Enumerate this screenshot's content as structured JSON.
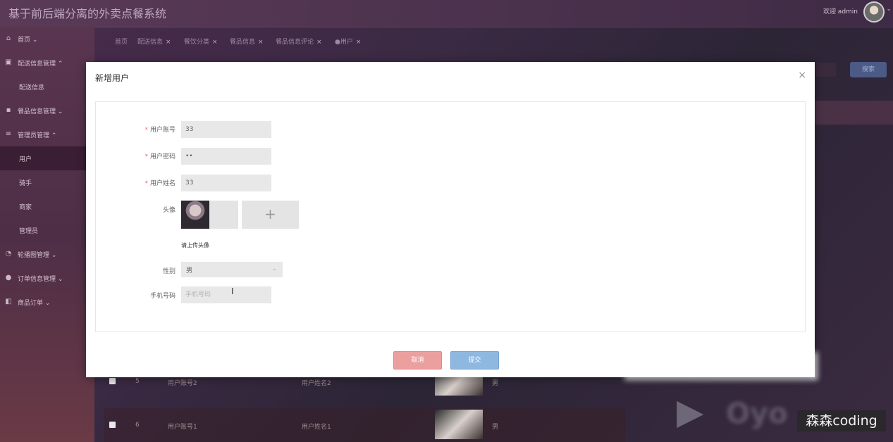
{
  "header": {
    "app_title": "基于前后端分离的外卖点餐系统",
    "welcome": "欢迎 admin",
    "avatar_icon": "user-avatar",
    "chevron_icon": "chevron-down-icon"
  },
  "sidebar": {
    "items": [
      {
        "label": "首页",
        "icon": "home-icon",
        "glyph": "⌂",
        "expand": "⌄"
      },
      {
        "label": "配送信息管理",
        "icon": "gift-icon",
        "glyph": "▣",
        "expand": "⌃"
      },
      {
        "label": "配送信息",
        "sub": true
      },
      {
        "label": "餐品信息管理",
        "icon": "grid-icon",
        "glyph": "▪",
        "expand": "⌄"
      },
      {
        "label": "管理员管理",
        "icon": "list-icon",
        "glyph": "≡",
        "expand": "⌃"
      },
      {
        "label": "用户",
        "sub": true,
        "active": true
      },
      {
        "label": "骑手",
        "sub": true
      },
      {
        "label": "商家",
        "sub": true
      },
      {
        "label": "管理员",
        "sub": true
      },
      {
        "label": "轮播图管理",
        "icon": "dashboard-icon",
        "glyph": "◔",
        "expand": "⌄"
      },
      {
        "label": "订单信息管理",
        "icon": "drop-icon",
        "glyph": "●",
        "expand": "⌄"
      },
      {
        "label": "商品订单",
        "icon": "layout-icon",
        "glyph": "◧",
        "expand": "⌄"
      }
    ]
  },
  "tabs": [
    {
      "label": "首页"
    },
    {
      "label": "配送信息",
      "close": "×"
    },
    {
      "label": "餐饮分类",
      "close": "×"
    },
    {
      "label": "餐品信息",
      "close": "×"
    },
    {
      "label": "餐品信息评论",
      "close": "×"
    },
    {
      "label": "●用户",
      "close": "×"
    }
  ],
  "toolbar": {
    "search_label": "搜索"
  },
  "background_rows": [
    {
      "id": "5",
      "account": "用户账号2",
      "name": "用户姓名2",
      "gender": "男"
    },
    {
      "id": "6",
      "account": "用户账号1",
      "name": "用户姓名1",
      "gender": "男"
    }
  ],
  "modal": {
    "title": "新增用户",
    "close": "×",
    "fields": {
      "account": {
        "label": "用户账号",
        "required": "*",
        "value": "33"
      },
      "password": {
        "label": "用户密码",
        "required": "*",
        "value": "••"
      },
      "name": {
        "label": "用户姓名",
        "required": "*",
        "value": "33"
      },
      "avatar": {
        "label": "头像",
        "plus": "+",
        "hint": "请上传头像"
      },
      "gender": {
        "label": "性别",
        "value": "男",
        "arrow": "⌄"
      },
      "phone": {
        "label": "手机号码",
        "value": "",
        "placeholder": "手机号码"
      }
    },
    "cancel_label": "取消",
    "submit_label": "提交"
  },
  "overlay": {
    "watermark": "森森coding",
    "play_glyph": "▶",
    "blur_text": "Oyo"
  },
  "colors": {
    "cancel": "#ec9f9f",
    "submit": "#8fb8e0",
    "required": "#f56c6c"
  }
}
